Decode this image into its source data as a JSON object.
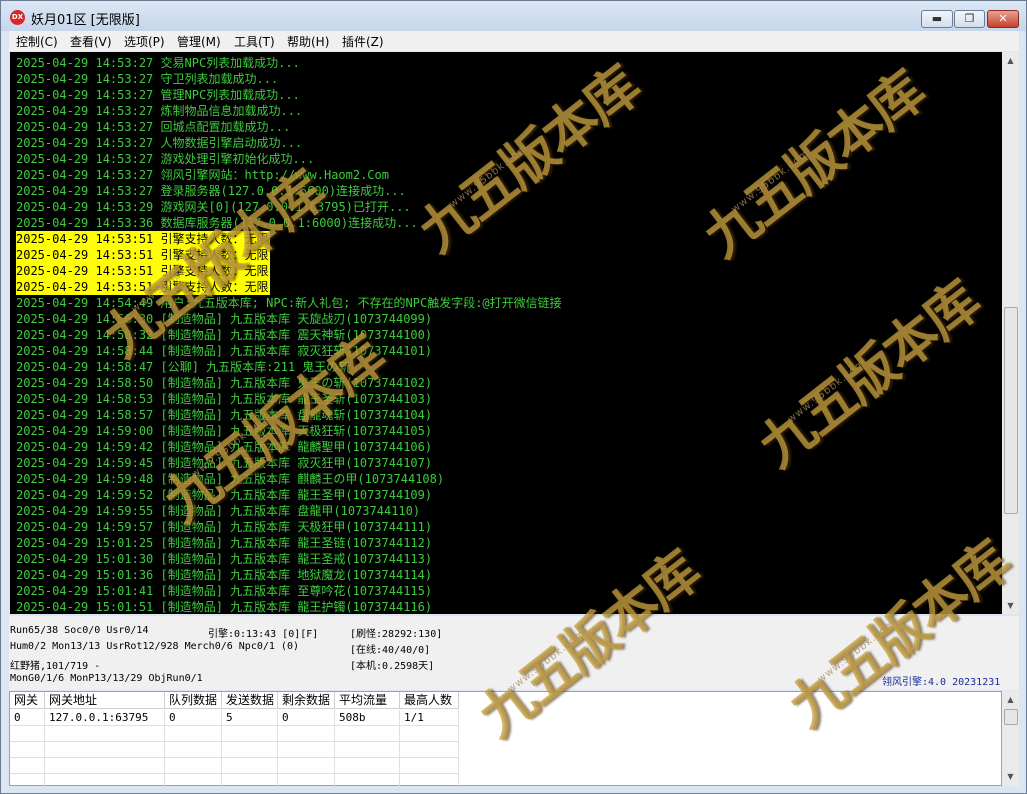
{
  "window": {
    "icon_text": "DX",
    "title": "妖月01区 [无限版]",
    "min_symbol": "▬",
    "max_symbol": "❐",
    "close_symbol": "✕"
  },
  "menu": [
    "控制(C)",
    "查看(V)",
    "选项(P)",
    "管理(M)",
    "工具(T)",
    "帮助(H)",
    "插件(Z)"
  ],
  "log": [
    "2025-04-29 14:53:27 交易NPC列表加载成功...",
    "2025-04-29 14:53:27 守卫列表加载成功...",
    "2025-04-29 14:53:27 管理NPC列表加载成功...",
    "2025-04-29 14:53:27 炼制物品信息加载成功...",
    "2025-04-29 14:53:27 回城点配置加载成功...",
    "2025-04-29 14:53:27 人物数据引擎启动成功...",
    "2025-04-29 14:53:27 游戏处理引擎初始化成功...",
    "2025-04-29 14:53:27 翎风引擎网站：http://www.Haom2.Com",
    "2025-04-29 14:53:27 登录服务器(127.0.0.1:5600)连接成功...",
    "2025-04-29 14:53:29 游戏网关[0](127.0.0.1:63795)已打开...",
    "2025-04-29 14:53:36 数据库服务器(127.0.0.1:6000)连接成功...",
    "2025-04-29 14:53:51 引擎支持人数：无限",
    "2025-04-29 14:53:51 引擎支持人数：无限",
    "2025-04-29 14:53:51 引擎支持人数：无限",
    "2025-04-29 14:53:51 引擎支持人数：无限",
    "2025-04-29 14:54:49 用户:九五版本库; NPC:新人礼包; 不存在的NPC触发字段:@打开微信链接",
    "2025-04-29 14:56:30 [制造物品] 九五版本库 天旋战刃(1073744099)",
    "2025-04-29 14:58:32 [制造物品] 九五版本库 震天神斩(1073744100)",
    "2025-04-29 14:58:44 [制造物品] 九五版本库 寂灭狂斩(1073744101)",
    "2025-04-29 14:58:47 [公聊] 九五版本库:211 鬼王の斩",
    "2025-04-29 14:58:50 [制造物品] 九五版本库 鬼王の斩(1073744102)",
    "2025-04-29 14:58:53 [制造物品] 九五版本库 龍王圣斩(1073744103)",
    "2025-04-29 14:58:57 [制造物品] 九五版本库 盘龍魂斩(1073744104)",
    "2025-04-29 14:59:00 [制造物品] 九五版本库 天极狂斩(1073744105)",
    "2025-04-29 14:59:42 [制造物品] 九五版本库 龍麟聖甲(1073744106)",
    "2025-04-29 14:59:45 [制造物品] 九五版本库 寂灭狂甲(1073744107)",
    "2025-04-29 14:59:48 [制造物品] 九五版本库 麒麟王の甲(1073744108)",
    "2025-04-29 14:59:52 [制造物品] 九五版本库 龍王圣甲(1073744109)",
    "2025-04-29 14:59:55 [制造物品] 九五版本库 盘龍甲(1073744110)",
    "2025-04-29 14:59:57 [制造物品] 九五版本库 天极狂甲(1073744111)",
    "2025-04-29 15:01:25 [制造物品] 九五版本库 龍王圣链(1073744112)",
    "2025-04-29 15:01:30 [制造物品] 九五版本库 龍王圣戒(1073744113)",
    "2025-04-29 15:01:36 [制造物品] 九五版本库 地狱魔龙(1073744114)",
    "2025-04-29 15:01:41 [制造物品] 九五版本库 至尊吟花(1073744115)",
    "2025-04-29 15:01:51 [制造物品] 九五版本库 龍王护镯(1073744116)"
  ],
  "highlight_color": "#ffff00",
  "log_text_color": "#3dcc3d",
  "status": {
    "run": "Run65/38 Soc0/0 Usr0/14",
    "hum": "Hum0/2 Mon13/13 UsrRot12/928 Merch0/6 Npc0/1 (0)",
    "map": "红野猪,101/719 -",
    "mon": "MonG0/1/6 MonP13/13/29 ObjRun0/1",
    "engine": "引擎:0:13:43 [0][F]",
    "refresh": "[刷怪:28292:130]",
    "online": "[在线:40/40/0]",
    "local": "[本机:0.2598天]",
    "version": "翎风引擎:4.0 20231231"
  },
  "gate_table": {
    "headers": [
      "网关",
      "网关地址",
      "队列数据",
      "发送数据",
      "剩余数据",
      "平均流量",
      "最高人数"
    ],
    "rows": [
      [
        "0",
        "127.0.0.1:63795",
        "0",
        "5",
        "0",
        "508b",
        "1/1"
      ]
    ]
  },
  "watermark": {
    "text": "九五版本库",
    "url": "www.95bbk.com"
  }
}
